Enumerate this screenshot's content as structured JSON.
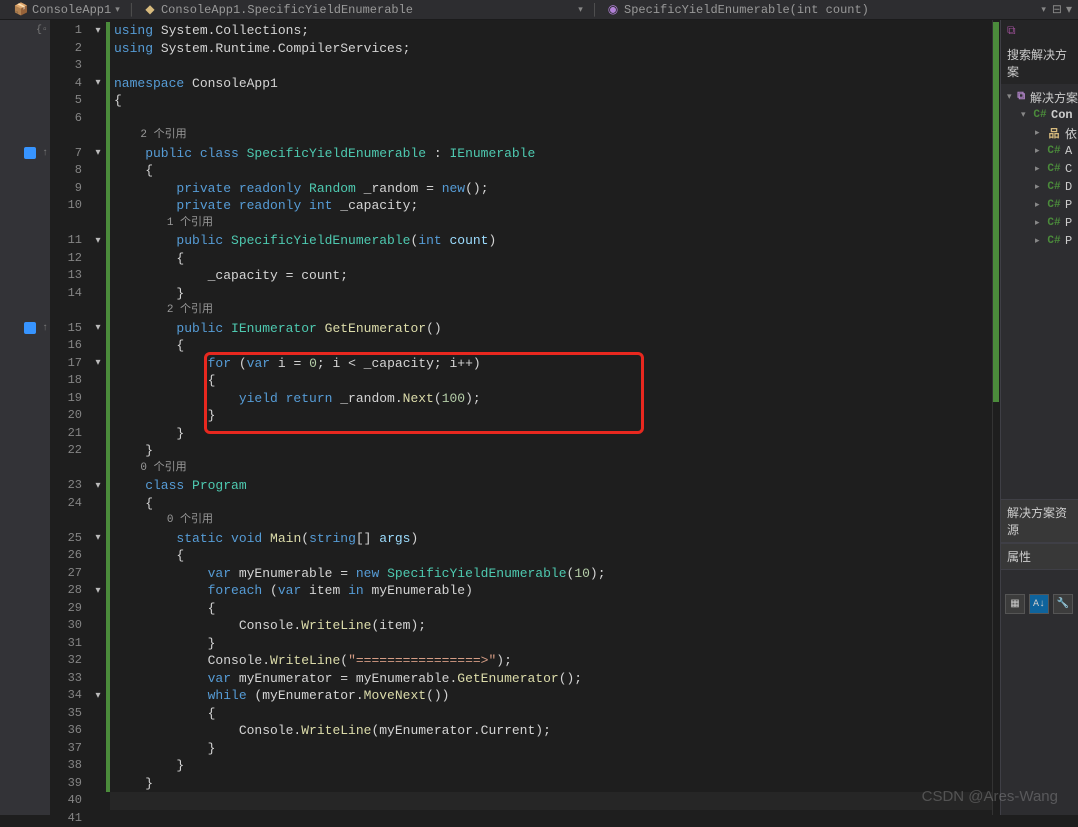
{
  "breadcrumb": {
    "project": "ConsoleApp1",
    "namespace": "ConsoleApp1.SpecificYieldEnumerable",
    "member": "SpecificYieldEnumerable(int count)"
  },
  "codelens": {
    "ref2": "2 个引用",
    "ref1": "1 个引用",
    "ref2b": "2 个引用",
    "ref0": "0 个引用",
    "ref0b": "0 个引用"
  },
  "code": {
    "l1a": "using",
    "l1b": " System.Collections;",
    "l2a": "using",
    "l2b": " System.Runtime.CompilerServices;",
    "l4a": "namespace",
    "l4b": " ConsoleApp1",
    "l5": "{",
    "l7a": "    public",
    "l7b": " class",
    "l7c": " SpecificYieldEnumerable",
    "l7d": " : ",
    "l7e": "IEnumerable",
    "l8": "    {",
    "l9a": "        private",
    "l9b": " readonly",
    "l9c": " Random",
    "l9d": " _random = ",
    "l9e": "new",
    "l9f": "();",
    "l10a": "        private",
    "l10b": " readonly",
    "l10c": " int",
    "l10d": " _capacity;",
    "l11a": "        public",
    "l11b": " SpecificYieldEnumerable",
    "l11c": "(",
    "l11d": "int",
    "l11e": " count",
    "l11f": ")",
    "l12": "        {",
    "l13": "            _capacity = count;",
    "l14": "        }",
    "l15a": "        public",
    "l15b": " IEnumerator",
    "l15c": " GetEnumerator",
    "l15d": "()",
    "l16": "        {",
    "l17a": "            for",
    "l17b": " (",
    "l17c": "var",
    "l17d": " i = ",
    "l17e": "0",
    "l17f": "; i < _capacity; i++)",
    "l18": "            {",
    "l19a": "                yield",
    "l19b": " return",
    "l19c": " _random.",
    "l19d": "Next",
    "l19e": "(",
    "l19f": "100",
    "l19g": ");",
    "l20": "            }",
    "l21": "        }",
    "l22": "    }",
    "l23a": "    class",
    "l23b": " Program",
    "l24": "    {",
    "l25a": "        static",
    "l25b": " void",
    "l25c": " Main",
    "l25d": "(",
    "l25e": "string",
    "l25f": "[] ",
    "l25g": "args",
    "l25h": ")",
    "l26": "        {",
    "l27a": "            var",
    "l27b": " myEnumerable = ",
    "l27c": "new",
    "l27d": " SpecificYieldEnumerable",
    "l27e": "(",
    "l27f": "10",
    "l27g": ");",
    "l28a": "            foreach",
    "l28b": " (",
    "l28c": "var",
    "l28d": " item ",
    "l28e": "in",
    "l28f": " myEnumerable)",
    "l29": "            {",
    "l30a": "                Console.",
    "l30b": "WriteLine",
    "l30c": "(item);",
    "l31": "            }",
    "l32a": "            Console.",
    "l32b": "WriteLine",
    "l32c": "(",
    "l32d": "\"================>\"",
    "l32e": ");",
    "l33a": "            var",
    "l33b": " myEnumerator = myEnumerable.",
    "l33c": "GetEnumerator",
    "l33d": "();",
    "l34a": "            while",
    "l34b": " (myEnumerator.",
    "l34c": "MoveNext",
    "l34d": "())",
    "l35": "            {",
    "l36a": "                Console.",
    "l36b": "WriteLine",
    "l36c": "(myEnumerator.Current);",
    "l37": "            }",
    "l38": "        }",
    "l39": "    }"
  },
  "lines": [
    "1",
    "2",
    "3",
    "4",
    "5",
    "6",
    "",
    "7",
    "8",
    "9",
    "10",
    "",
    "11",
    "12",
    "13",
    "14",
    "",
    "15",
    "16",
    "17",
    "18",
    "19",
    "20",
    "21",
    "22",
    "",
    "23",
    "24",
    "",
    "25",
    "26",
    "27",
    "28",
    "29",
    "30",
    "31",
    "32",
    "33",
    "34",
    "35",
    "36",
    "37",
    "38",
    "39",
    "40",
    "41"
  ],
  "side": {
    "search": "搜索解决方案",
    "solutionExplorer": "解决方案",
    "project": "Con",
    "items": [
      "依",
      "A",
      "C",
      "D",
      "P",
      "P",
      "P"
    ],
    "explorerTab": "解决方案资源",
    "properties": "属性"
  },
  "watermark": "CSDN @Ares-Wang",
  "propButtons": {
    "cat": "▦",
    "az": "A↓",
    "wrench": "🔧"
  }
}
